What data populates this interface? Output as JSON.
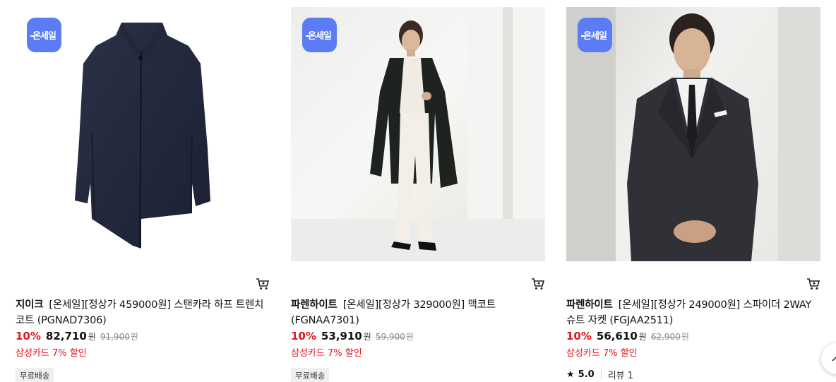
{
  "badge_label": "온세일",
  "products": [
    {
      "brand": "지이크",
      "name": "[온세일][정상가 459000원] 스탠카라 하프 트렌치 코트 (PGNAD7306)",
      "discount_rate": "10%",
      "price": "82,710",
      "currency": "원",
      "original_price": "91,900",
      "card_discount": "삼성카드 7% 할인",
      "tag": "무료배송"
    },
    {
      "brand": "파렌하이트",
      "name": "[온세일][정상가 329000원] 맥코트 (FGNAA7301)",
      "discount_rate": "10%",
      "price": "53,910",
      "currency": "원",
      "original_price": "59,900",
      "card_discount": "삼성카드 7% 할인",
      "tag": "무료배송"
    },
    {
      "brand": "파렌하이트",
      "name": "[온세일][정상가 249000원] 스파이더 2WAY 슈트 자켓 (FGJAA2511)",
      "discount_rate": "10%",
      "price": "56,610",
      "currency": "원",
      "original_price": "62,900",
      "card_discount": "삼성카드 7% 할인",
      "rating": "5.0",
      "review_label": "리뷰 1"
    }
  ],
  "icons": {
    "cart": "cart-icon",
    "star": "star-icon",
    "scroll_top": "chevron-up-icon"
  },
  "colors": {
    "badge": "#5b7cf5",
    "discount": "#e0141e"
  }
}
